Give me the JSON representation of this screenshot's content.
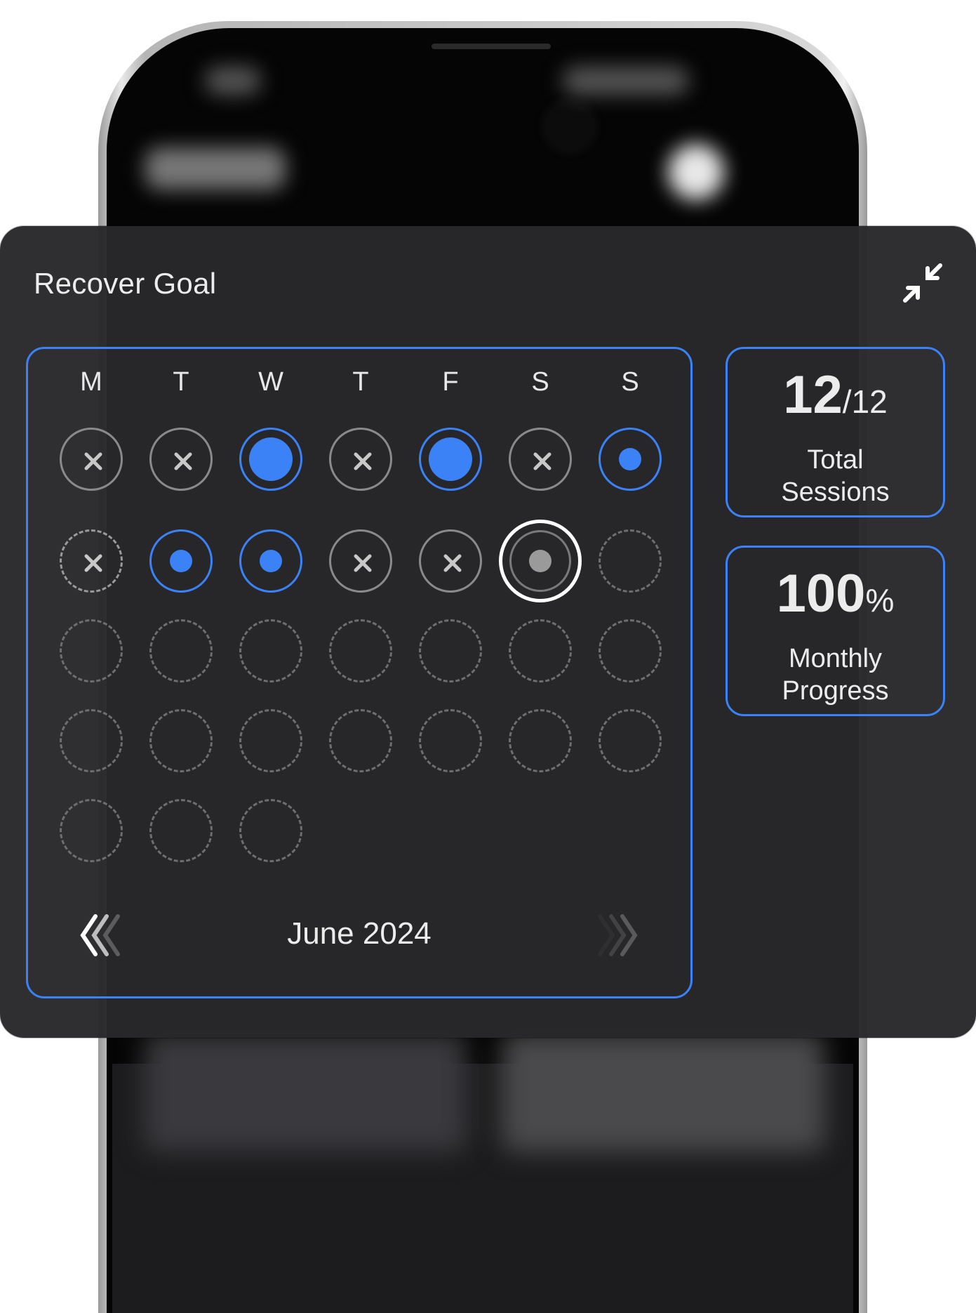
{
  "widget": {
    "title": "Recover Goal",
    "collapse_icon": "collapse-arrows-icon"
  },
  "calendar": {
    "weekdays": [
      "M",
      "T",
      "W",
      "T",
      "F",
      "S",
      "S"
    ],
    "month_label": "June 2024",
    "prev_icon": "chevron-double-left-icon",
    "next_icon": "chevron-double-right-icon",
    "rows": [
      [
        "missed",
        "missed",
        "done-large",
        "missed",
        "done-large",
        "missed",
        "done-small"
      ],
      [
        "missed-dashed",
        "done-small",
        "done-small",
        "missed",
        "missed",
        "today",
        "future"
      ],
      [
        "future",
        "future",
        "future",
        "future",
        "future",
        "future",
        "future"
      ],
      [
        "future",
        "future",
        "future",
        "future",
        "future",
        "future",
        "future"
      ],
      [
        "future",
        "future",
        "future"
      ]
    ]
  },
  "stats": {
    "sessions": {
      "value": "12",
      "total": "/12",
      "label_line1": "Total",
      "label_line2": "Sessions"
    },
    "progress": {
      "value": "100",
      "unit": "%",
      "label_line1": "Monthly",
      "label_line2": "Progress"
    }
  },
  "colors": {
    "accent": "#3b82f6",
    "panel": "#28282a",
    "missed": "#8a8a8a",
    "today_ring": "#ffffff"
  }
}
